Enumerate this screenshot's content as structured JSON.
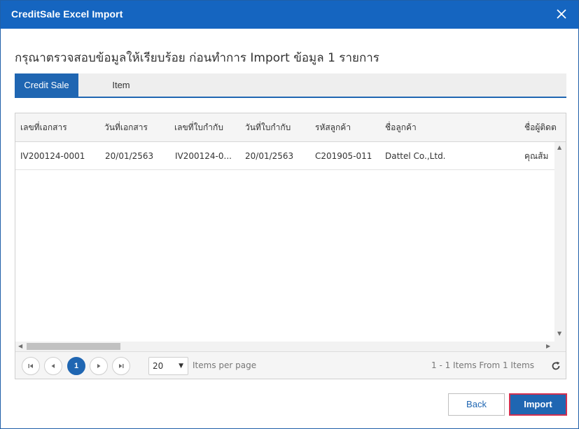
{
  "dialog": {
    "title": "CreditSale Excel Import",
    "heading": "กรุณาตรวจสอบข้อมูลให้เรียบร้อย ก่อนทำการ Import ข้อมูล 1 รายการ"
  },
  "tabs": [
    {
      "label": "Credit Sale",
      "active": true
    },
    {
      "label": "Item",
      "active": false
    }
  ],
  "grid": {
    "columns": [
      "เลขที่เอกสาร",
      "วันที่เอกสาร",
      "เลขที่ใบกำกับ",
      "วันที่ใบกำกับ",
      "รหัสลูกค้า",
      "ชื่อลูกค้า",
      "ชื่อผู้ติดต"
    ],
    "rows": [
      [
        "IV200124-0001",
        "20/01/2563",
        "IV200124-0...",
        "20/01/2563",
        "C201905-011",
        "Dattel Co.,Ltd.",
        "คุณส้ม"
      ]
    ]
  },
  "pager": {
    "current_page": "1",
    "page_size": "20",
    "items_per_page_label": "Items per page",
    "info": "1 - 1 Items From 1 Items"
  },
  "footer": {
    "back_label": "Back",
    "import_label": "Import"
  },
  "colors": {
    "titlebar": "#1565c0",
    "accent": "#1f66b2",
    "import_border": "#d32f4f"
  },
  "icons": {
    "close": "close-icon",
    "first": "first-page-icon",
    "prev": "prev-page-icon",
    "next": "next-page-icon",
    "last": "last-page-icon",
    "dropdown": "chevron-down-icon",
    "refresh": "refresh-icon"
  }
}
